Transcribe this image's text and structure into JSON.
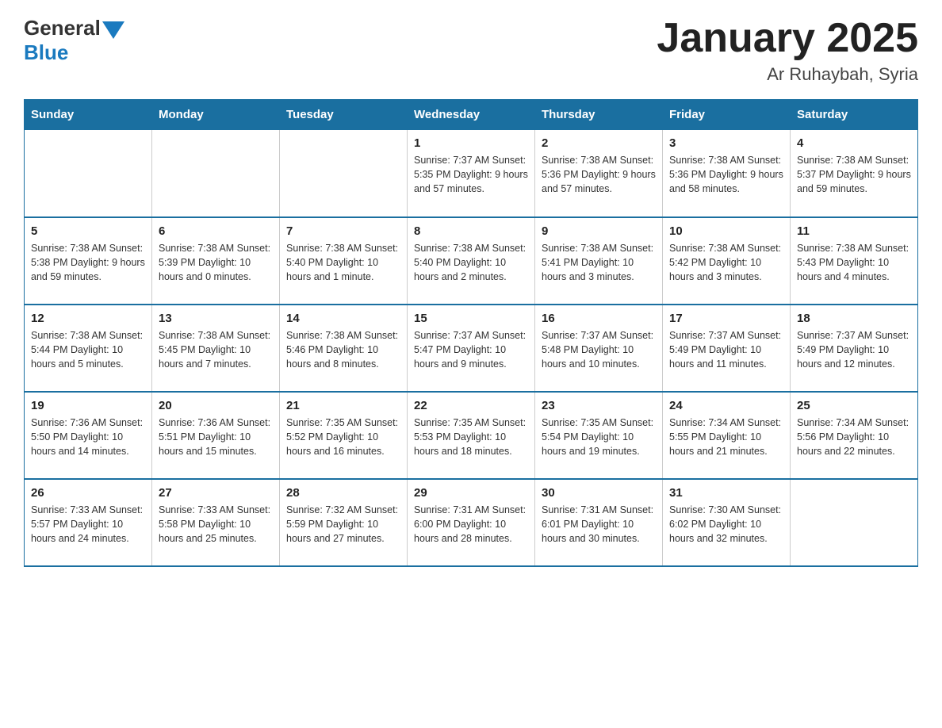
{
  "header": {
    "title": "January 2025",
    "subtitle": "Ar Ruhaybah, Syria",
    "logo_general": "General",
    "logo_blue": "Blue"
  },
  "weekdays": [
    "Sunday",
    "Monday",
    "Tuesday",
    "Wednesday",
    "Thursday",
    "Friday",
    "Saturday"
  ],
  "weeks": [
    [
      {
        "day": "",
        "info": ""
      },
      {
        "day": "",
        "info": ""
      },
      {
        "day": "",
        "info": ""
      },
      {
        "day": "1",
        "info": "Sunrise: 7:37 AM\nSunset: 5:35 PM\nDaylight: 9 hours\nand 57 minutes."
      },
      {
        "day": "2",
        "info": "Sunrise: 7:38 AM\nSunset: 5:36 PM\nDaylight: 9 hours\nand 57 minutes."
      },
      {
        "day": "3",
        "info": "Sunrise: 7:38 AM\nSunset: 5:36 PM\nDaylight: 9 hours\nand 58 minutes."
      },
      {
        "day": "4",
        "info": "Sunrise: 7:38 AM\nSunset: 5:37 PM\nDaylight: 9 hours\nand 59 minutes."
      }
    ],
    [
      {
        "day": "5",
        "info": "Sunrise: 7:38 AM\nSunset: 5:38 PM\nDaylight: 9 hours\nand 59 minutes."
      },
      {
        "day": "6",
        "info": "Sunrise: 7:38 AM\nSunset: 5:39 PM\nDaylight: 10 hours\nand 0 minutes."
      },
      {
        "day": "7",
        "info": "Sunrise: 7:38 AM\nSunset: 5:40 PM\nDaylight: 10 hours\nand 1 minute."
      },
      {
        "day": "8",
        "info": "Sunrise: 7:38 AM\nSunset: 5:40 PM\nDaylight: 10 hours\nand 2 minutes."
      },
      {
        "day": "9",
        "info": "Sunrise: 7:38 AM\nSunset: 5:41 PM\nDaylight: 10 hours\nand 3 minutes."
      },
      {
        "day": "10",
        "info": "Sunrise: 7:38 AM\nSunset: 5:42 PM\nDaylight: 10 hours\nand 3 minutes."
      },
      {
        "day": "11",
        "info": "Sunrise: 7:38 AM\nSunset: 5:43 PM\nDaylight: 10 hours\nand 4 minutes."
      }
    ],
    [
      {
        "day": "12",
        "info": "Sunrise: 7:38 AM\nSunset: 5:44 PM\nDaylight: 10 hours\nand 5 minutes."
      },
      {
        "day": "13",
        "info": "Sunrise: 7:38 AM\nSunset: 5:45 PM\nDaylight: 10 hours\nand 7 minutes."
      },
      {
        "day": "14",
        "info": "Sunrise: 7:38 AM\nSunset: 5:46 PM\nDaylight: 10 hours\nand 8 minutes."
      },
      {
        "day": "15",
        "info": "Sunrise: 7:37 AM\nSunset: 5:47 PM\nDaylight: 10 hours\nand 9 minutes."
      },
      {
        "day": "16",
        "info": "Sunrise: 7:37 AM\nSunset: 5:48 PM\nDaylight: 10 hours\nand 10 minutes."
      },
      {
        "day": "17",
        "info": "Sunrise: 7:37 AM\nSunset: 5:49 PM\nDaylight: 10 hours\nand 11 minutes."
      },
      {
        "day": "18",
        "info": "Sunrise: 7:37 AM\nSunset: 5:49 PM\nDaylight: 10 hours\nand 12 minutes."
      }
    ],
    [
      {
        "day": "19",
        "info": "Sunrise: 7:36 AM\nSunset: 5:50 PM\nDaylight: 10 hours\nand 14 minutes."
      },
      {
        "day": "20",
        "info": "Sunrise: 7:36 AM\nSunset: 5:51 PM\nDaylight: 10 hours\nand 15 minutes."
      },
      {
        "day": "21",
        "info": "Sunrise: 7:35 AM\nSunset: 5:52 PM\nDaylight: 10 hours\nand 16 minutes."
      },
      {
        "day": "22",
        "info": "Sunrise: 7:35 AM\nSunset: 5:53 PM\nDaylight: 10 hours\nand 18 minutes."
      },
      {
        "day": "23",
        "info": "Sunrise: 7:35 AM\nSunset: 5:54 PM\nDaylight: 10 hours\nand 19 minutes."
      },
      {
        "day": "24",
        "info": "Sunrise: 7:34 AM\nSunset: 5:55 PM\nDaylight: 10 hours\nand 21 minutes."
      },
      {
        "day": "25",
        "info": "Sunrise: 7:34 AM\nSunset: 5:56 PM\nDaylight: 10 hours\nand 22 minutes."
      }
    ],
    [
      {
        "day": "26",
        "info": "Sunrise: 7:33 AM\nSunset: 5:57 PM\nDaylight: 10 hours\nand 24 minutes."
      },
      {
        "day": "27",
        "info": "Sunrise: 7:33 AM\nSunset: 5:58 PM\nDaylight: 10 hours\nand 25 minutes."
      },
      {
        "day": "28",
        "info": "Sunrise: 7:32 AM\nSunset: 5:59 PM\nDaylight: 10 hours\nand 27 minutes."
      },
      {
        "day": "29",
        "info": "Sunrise: 7:31 AM\nSunset: 6:00 PM\nDaylight: 10 hours\nand 28 minutes."
      },
      {
        "day": "30",
        "info": "Sunrise: 7:31 AM\nSunset: 6:01 PM\nDaylight: 10 hours\nand 30 minutes."
      },
      {
        "day": "31",
        "info": "Sunrise: 7:30 AM\nSunset: 6:02 PM\nDaylight: 10 hours\nand 32 minutes."
      },
      {
        "day": "",
        "info": ""
      }
    ]
  ]
}
